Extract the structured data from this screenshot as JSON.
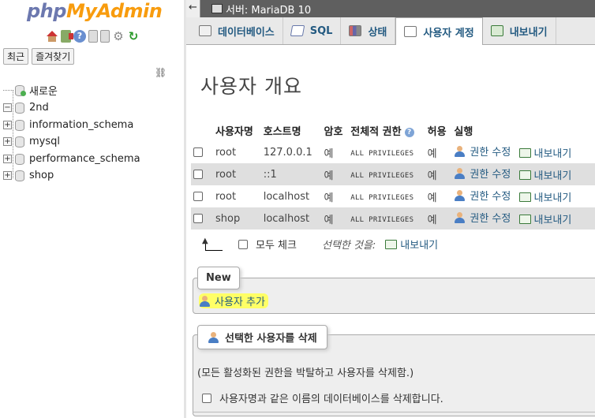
{
  "app": {
    "logo_php": "php",
    "logo_myadmin": "MyAdmin",
    "server_breadcrumb": "서버: MariaDB 10"
  },
  "nav": {
    "recent": "최근",
    "favorites": "즐겨찾기",
    "tree": [
      {
        "label": "새로운",
        "icon": "new-db-icon"
      },
      {
        "label": "2nd",
        "expander": "−"
      },
      {
        "label": "information_schema",
        "expander": "+"
      },
      {
        "label": "mysql",
        "expander": "+"
      },
      {
        "label": "performance_schema",
        "expander": "+"
      },
      {
        "label": "shop",
        "expander": "+"
      }
    ]
  },
  "tabs": [
    {
      "label": "데이터베이스",
      "icon": "database-icon"
    },
    {
      "label": "SQL",
      "icon": "sql-icon"
    },
    {
      "label": "상태",
      "icon": "status-icon"
    },
    {
      "label": "사용자 계정",
      "icon": "users-icon",
      "active": true
    },
    {
      "label": "내보내기",
      "icon": "export-icon"
    }
  ],
  "page_title": "사용자 개요",
  "table": {
    "headers": [
      "사용자명",
      "호스트명",
      "암호",
      "전체적 권한",
      "허용",
      "실행"
    ],
    "rows": [
      {
        "user": "root",
        "host": "127.0.0.1",
        "password": "예",
        "privileges": "ALL PRIVILEGES",
        "grant": "예"
      },
      {
        "user": "root",
        "host": "::1",
        "password": "예",
        "privileges": "ALL PRIVILEGES",
        "grant": "예"
      },
      {
        "user": "root",
        "host": "localhost",
        "password": "예",
        "privileges": "ALL PRIVILEGES",
        "grant": "예"
      },
      {
        "user": "shop",
        "host": "localhost",
        "password": "예",
        "privileges": "ALL PRIVILEGES",
        "grant": "예"
      }
    ],
    "edit_label": "권한 수정",
    "export_label": "내보내기"
  },
  "with_selected": {
    "check_all": "모두 체크",
    "label": "선택한 것을:",
    "export": "내보내기"
  },
  "new_section": {
    "legend": "New",
    "add_user": "사용자 추가"
  },
  "delete_section": {
    "button": "선택한 사용자를 삭제",
    "note": "(모든 활성화된 권한을 박탈하고 사용자를 삭제함.)",
    "drop_db": "사용자명과 같은 이름의 데이터베이스를 삭제합니다."
  },
  "colors": {
    "link": "#235a81",
    "highlight": "#ffff66",
    "logo_php": "#6c78af",
    "logo_myadmin": "#f89c0e"
  }
}
